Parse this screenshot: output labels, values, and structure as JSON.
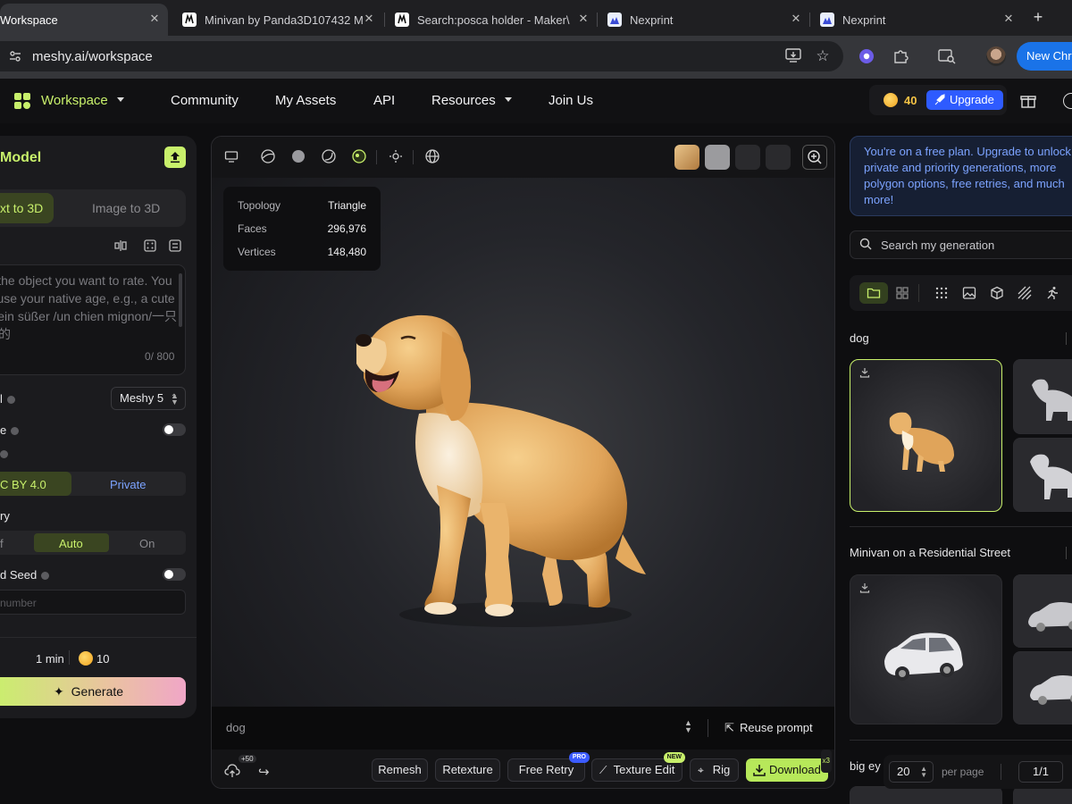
{
  "browser": {
    "tabs": [
      {
        "title": "Workspace",
        "favicon": "meshy-favicon",
        "active": true
      },
      {
        "title": "Minivan by Panda3D107432 M",
        "favicon": "makerworld-favicon",
        "active": false
      },
      {
        "title": "Search:posca holder - Maker\\",
        "favicon": "makerworld-favicon",
        "active": false
      },
      {
        "title": "Nexprint",
        "favicon": "nexprint-favicon",
        "active": false
      },
      {
        "title": "Nexprint",
        "favicon": "nexprint-favicon",
        "active": false
      }
    ],
    "url": "meshy.ai/workspace",
    "new_chrome_label": "New Chr"
  },
  "header": {
    "workspace_label": "Workspace",
    "nav": [
      "Community",
      "My Assets",
      "API",
      "Resources",
      "Join Us"
    ],
    "credits": "40",
    "upgrade_label": "Upgrade"
  },
  "left_panel": {
    "title": "Model",
    "mode_tabs": [
      "xt to 3D",
      "Image to 3D"
    ],
    "prompt_placeholder": "ribe the object you want to rate. You can use your native age, e.g., a cute dog/ein süßer /un chien mignon/一只可爱的",
    "prompt_count": "0/ 800",
    "model_label": "l",
    "model_value": "Meshy 5",
    "row2_label": "e",
    "license_options": [
      "C BY 4.0",
      "Private"
    ],
    "retry_label": "ry",
    "retry_options": [
      "f",
      "Auto",
      "On"
    ],
    "seed_label": "d Seed",
    "seed_placeholder": " number",
    "time": "1 min",
    "cost": "10",
    "generate_label": "Generate"
  },
  "viewer": {
    "stats": [
      {
        "k": "Topology",
        "v": "Triangle"
      },
      {
        "k": "Faces",
        "v": "296,976"
      },
      {
        "k": "Vertices",
        "v": "148,480"
      }
    ],
    "prompt": "dog",
    "reuse_label": "Reuse prompt",
    "upload_badge": "+50",
    "actions": [
      "Remesh",
      "Retexture",
      "Free Retry",
      "Texture Edit",
      "Rig"
    ],
    "pro_badge": "PRO",
    "new_badge": "NEW",
    "download_label": "Download",
    "download_badge": "x3"
  },
  "right_panel": {
    "plan_text": "You're on a free plan. Upgrade to unlock private and priority generations, more polygon options, free retries, and much more!",
    "search_placeholder": "Search my generation",
    "groups": [
      "dog",
      "Minivan on a Residential Street",
      "big ey"
    ],
    "per_page_value": "20",
    "per_page_label": "per page",
    "page": "1/1"
  },
  "colors": {
    "accent": "#c8f06b",
    "upgrade": "#2e5bff",
    "download": "#b7e85a",
    "info_text": "#7ca3ff"
  }
}
